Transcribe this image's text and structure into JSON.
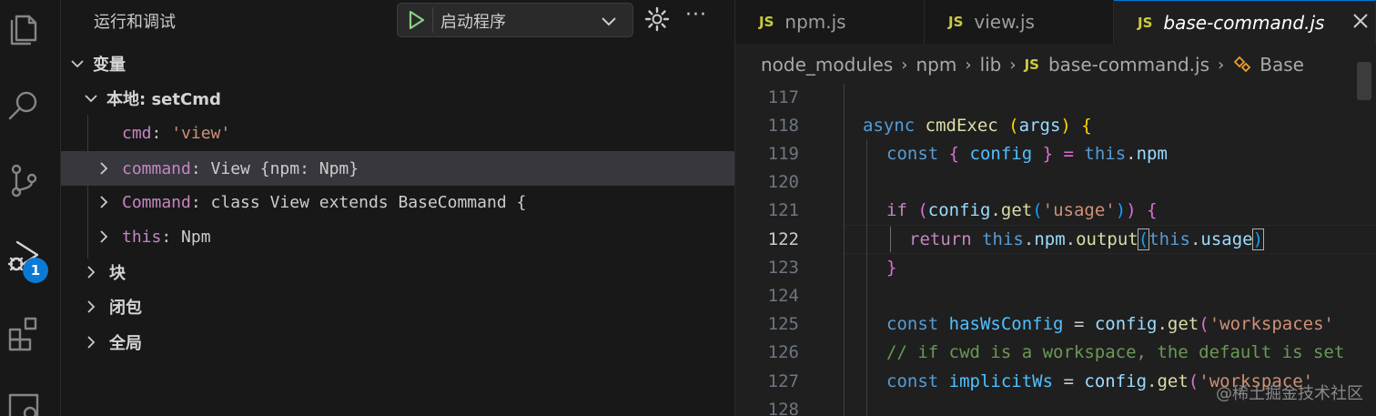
{
  "activity_bar": {
    "items": [
      {
        "name": "explorer",
        "icon": "files-icon"
      },
      {
        "name": "search",
        "icon": "search-icon"
      },
      {
        "name": "source-control",
        "icon": "source-control-icon"
      },
      {
        "name": "run-and-debug",
        "icon": "debug-icon",
        "badge": "1",
        "active": true
      },
      {
        "name": "extensions",
        "icon": "extensions-icon"
      },
      {
        "name": "remote",
        "icon": "remote-icon"
      }
    ]
  },
  "sidebar": {
    "title": "运行和调试",
    "launch_config": "启动程序",
    "more_label": "···",
    "variables_section": "变量",
    "local_scope": "本地: setCmd",
    "variables": [
      {
        "name": "cmd",
        "sep": ": ",
        "value": "'view'",
        "kind": "string",
        "expandable": false
      },
      {
        "name": "command",
        "sep": ": ",
        "value": "View {npm: Npm}",
        "kind": "object",
        "expandable": true,
        "selected": true
      },
      {
        "name": "Command",
        "sep": ": ",
        "value": "class View extends BaseCommand {",
        "kind": "object",
        "expandable": true
      },
      {
        "name": "this",
        "sep": ": ",
        "value": "Npm",
        "kind": "object",
        "expandable": true
      }
    ],
    "scopes": [
      "块",
      "闭包",
      "全局"
    ]
  },
  "editor": {
    "tabs": [
      {
        "label": "npm.js",
        "icon": "JS"
      },
      {
        "label": "view.js",
        "icon": "JS"
      },
      {
        "label": "base-command.js",
        "icon": "JS",
        "active": true
      }
    ],
    "breadcrumb": [
      "node_modules",
      "npm",
      "lib",
      "base-command.js",
      "Base"
    ],
    "breadcrumb_file_icon": "JS",
    "line_numbers": [
      "117",
      "118",
      "119",
      "120",
      "121",
      "122",
      "123",
      "124",
      "125",
      "126",
      "127",
      "128"
    ],
    "current_line": "122",
    "code": {
      "l118": {
        "kw": "async",
        "fn": "cmdExec",
        "p1": " (",
        "arg": "args",
        "p2": ") {"
      },
      "l119": {
        "kw": "const",
        "b1": " { ",
        "v": "config",
        "b2": " } = ",
        "th": "this",
        "dot": ".",
        "prop": "npm"
      },
      "l121": {
        "kw": "if",
        "p1": " (",
        "v": "config",
        "dot": ".",
        "fn": "get",
        "p2": "(",
        "str": "'usage'",
        "p3": ")",
        "p4": ")",
        "p5": " {"
      },
      "l122": {
        "kw": "return",
        "th": "this",
        "d1": ".",
        "v1": "npm",
        "d2": ".",
        "fn": "output",
        "po": "(",
        "th2": "this",
        "d3": ".",
        "v2": "usage",
        "pc": ")"
      },
      "l123": {
        "br": "}"
      },
      "l125": {
        "kw": "const",
        "v": "hasWsConfig",
        "eq": " = ",
        "v2": "config",
        "d": ".",
        "fn": "get",
        "po": "(",
        "str": "'workspaces'"
      },
      "l126": {
        "comment": "// if cwd is a workspace, the default is set"
      },
      "l127": {
        "kw": "const",
        "v": "implicitWs",
        "eq": " = ",
        "v2": "config",
        "d": ".",
        "fn": "get",
        "po": "(",
        "str": "'workspace'"
      }
    }
  },
  "watermark": "@稀土掘金技术社区",
  "colors": {
    "accent": "#0078d4",
    "badge": "#0a7ad4",
    "js_icon": "#cbcb41"
  }
}
